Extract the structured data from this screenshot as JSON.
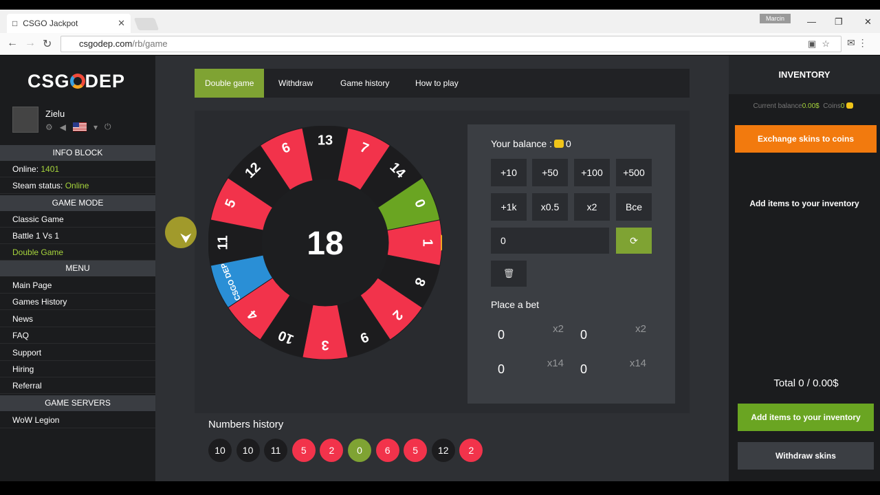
{
  "browser": {
    "tab_title": "CSGO Jackpot",
    "profile": "Marcin",
    "url_domain": "csgodep.com",
    "url_path": "/rb/game"
  },
  "sidebar": {
    "logo_left": "CSG",
    "logo_right": "DEP",
    "username": "Zielu",
    "info_block": "INFO BLOCK",
    "online_label": "Online: ",
    "online_value": "1401",
    "steam_label": "Steam status: ",
    "steam_value": "Online",
    "game_mode": "GAME MODE",
    "modes": [
      "Classic Game",
      "Battle 1 Vs 1",
      "Double Game"
    ],
    "menu": "MENU",
    "menu_items": [
      "Main Page",
      "Games History",
      "News",
      "FAQ",
      "Support",
      "Hiring",
      "Referral"
    ],
    "game_servers": "GAME SERVERS",
    "servers": [
      "WoW Legion"
    ]
  },
  "tabs": [
    "Double game",
    "Withdraw",
    "Game history",
    "How to play"
  ],
  "wheel": {
    "center_number": "18",
    "segments": [
      {
        "label": "13",
        "color": "#1c1c1e"
      },
      {
        "label": "7",
        "color": "#f2334b"
      },
      {
        "label": "14",
        "color": "#1c1c1e"
      },
      {
        "label": "0",
        "color": "#6aa522"
      },
      {
        "label": "1",
        "color": "#f2334b"
      },
      {
        "label": "8",
        "color": "#1c1c1e"
      },
      {
        "label": "2",
        "color": "#f2334b"
      },
      {
        "label": "9",
        "color": "#1c1c1e"
      },
      {
        "label": "3",
        "color": "#f2334b"
      },
      {
        "label": "10",
        "color": "#1c1c1e"
      },
      {
        "label": "4",
        "color": "#f2334b"
      },
      {
        "label": "CSGO DEP",
        "color": "#2a8fd6"
      },
      {
        "label": "11",
        "color": "#1c1c1e"
      },
      {
        "label": "5",
        "color": "#f2334b"
      },
      {
        "label": "12",
        "color": "#1c1c1e"
      },
      {
        "label": "6",
        "color": "#f2334b"
      }
    ]
  },
  "bet": {
    "balance_label": "Your balance :",
    "balance_value": "0",
    "quick": [
      "+10",
      "+50",
      "+100",
      "+500",
      "+1k",
      "x0.5",
      "x2",
      "Все"
    ],
    "input_value": "0",
    "place_label": "Place a bet",
    "boxes": [
      {
        "value": "0",
        "mult": "x2",
        "color": "#f2334b"
      },
      {
        "value": "0",
        "mult": "x2",
        "color": "#1f2023"
      },
      {
        "value": "0",
        "mult": "x14",
        "color": "#7fa333"
      },
      {
        "value": "0",
        "mult": "x14",
        "color": "#3b87d6"
      }
    ]
  },
  "history": {
    "label": "Numbers history",
    "numbers": [
      {
        "n": "10",
        "color": "#1c1c1e"
      },
      {
        "n": "10",
        "color": "#1c1c1e"
      },
      {
        "n": "11",
        "color": "#1c1c1e"
      },
      {
        "n": "5",
        "color": "#f2334b"
      },
      {
        "n": "2",
        "color": "#f2334b"
      },
      {
        "n": "0",
        "color": "#7fa333"
      },
      {
        "n": "6",
        "color": "#f2334b"
      },
      {
        "n": "5",
        "color": "#f2334b"
      },
      {
        "n": "12",
        "color": "#1c1c1e"
      },
      {
        "n": "2",
        "color": "#f2334b"
      }
    ]
  },
  "inventory": {
    "title": "INVENTORY",
    "current_balance_label": "Current balance",
    "current_balance_value": "0.00$",
    "coins_label": "Coins",
    "coins_value": "0",
    "exchange": "Exchange skins to coins",
    "empty_text": "Add items to your inventory",
    "total": "Total 0 / 0.00$",
    "add_button": "Add items to your inventory",
    "withdraw_button": "Withdraw skins"
  }
}
